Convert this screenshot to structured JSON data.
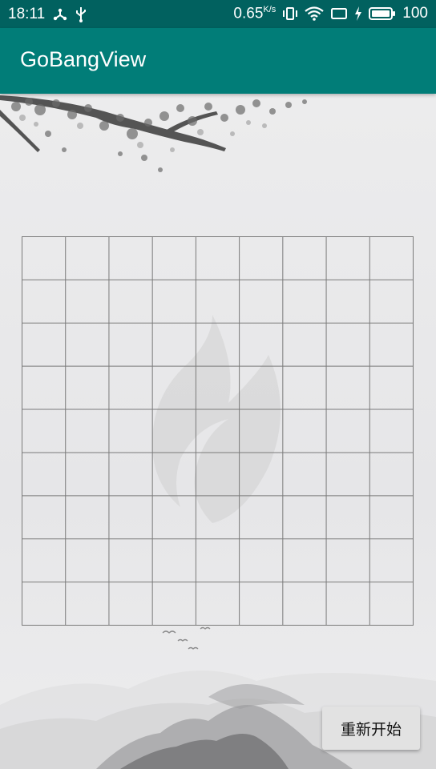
{
  "status_bar": {
    "time": "18:11",
    "net_speed": "0.65",
    "net_unit": "K/s",
    "battery": "100",
    "icons": [
      "usb-tree-icon",
      "usb-icon",
      "vibrate-icon",
      "wifi-icon",
      "screen-cast-icon",
      "charging-icon",
      "battery-icon"
    ]
  },
  "app_bar": {
    "title": "GoBangView"
  },
  "board": {
    "columns": 9,
    "rows": 9,
    "line_color": "#7a7a7a"
  },
  "restart_button": {
    "label": "重新开始"
  },
  "colors": {
    "status_bar": "#01615f",
    "app_bar": "#017d78",
    "background": "#e9e9ea"
  }
}
